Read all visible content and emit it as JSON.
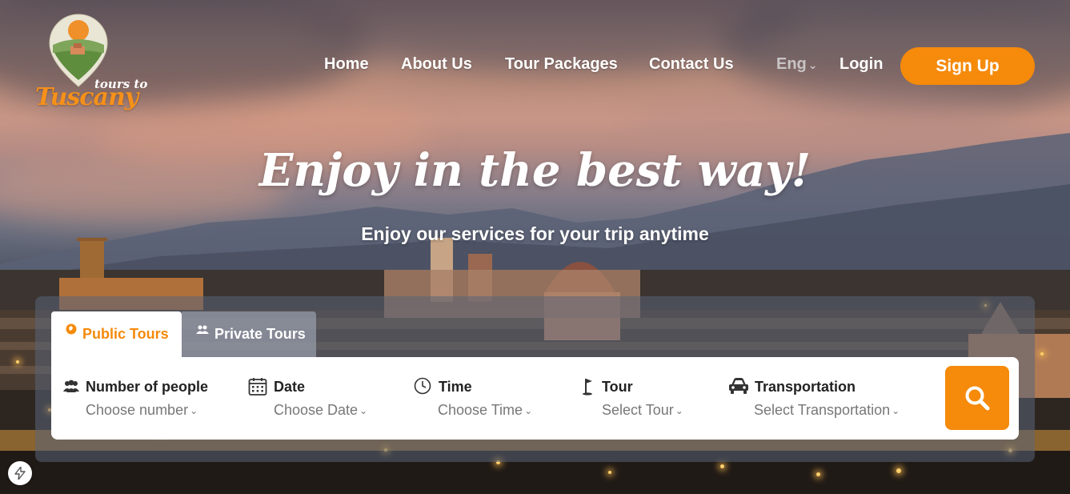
{
  "brand": {
    "logo_small": "tours to",
    "logo_big": "Tuscany"
  },
  "nav": {
    "items": [
      {
        "label": "Home"
      },
      {
        "label": "About Us"
      },
      {
        "label": "Tour Packages"
      },
      {
        "label": "Contact Us"
      }
    ],
    "language": "Eng",
    "login": "Login",
    "signup": "Sign Up"
  },
  "hero": {
    "headline": "Enjoy in the best way!",
    "subheadline": "Enjoy our services for your trip anytime"
  },
  "search": {
    "tabs": [
      {
        "label": "Public Tours",
        "icon": "globe-icon",
        "active": true
      },
      {
        "label": "Private Tours",
        "icon": "group-icon",
        "active": false
      }
    ],
    "fields": [
      {
        "label": "Number of people",
        "placeholder": "Choose number",
        "icon": "people-icon"
      },
      {
        "label": "Date",
        "placeholder": "Choose Date",
        "icon": "calendar-icon"
      },
      {
        "label": "Time",
        "placeholder": "Choose Time",
        "icon": "clock-icon"
      },
      {
        "label": "Tour",
        "placeholder": "Select Tour",
        "icon": "golf-flag-icon"
      },
      {
        "label": "Transportation",
        "placeholder": "Select Transportation",
        "icon": "car-icon"
      }
    ],
    "submit_icon": "search-icon"
  },
  "colors": {
    "accent": "#f58a0b",
    "text_dark": "#222222",
    "text_muted": "#777777"
  }
}
